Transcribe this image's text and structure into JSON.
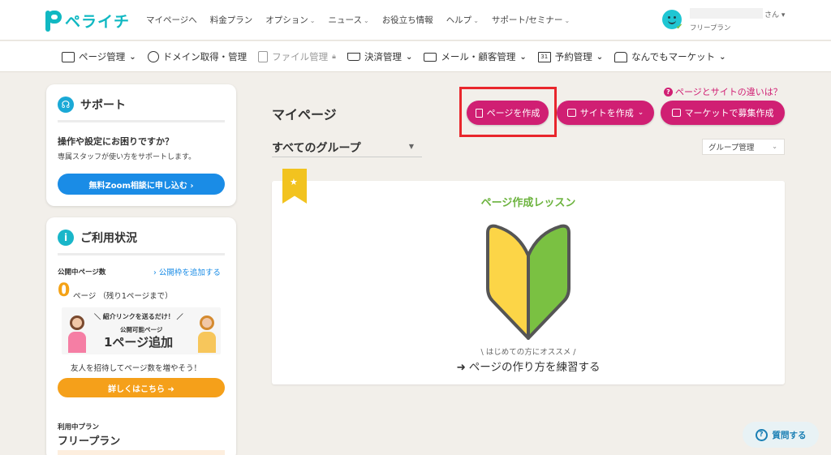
{
  "app": {
    "logo_text": "ペライチ"
  },
  "top_nav": {
    "items": [
      {
        "label": "マイページへ",
        "has_caret": false
      },
      {
        "label": "料金プラン",
        "has_caret": false
      },
      {
        "label": "オプション",
        "has_caret": true
      },
      {
        "label": "ニュース",
        "has_caret": true
      },
      {
        "label": "お役立ち情報",
        "has_caret": false
      },
      {
        "label": "ヘルプ",
        "has_caret": true
      },
      {
        "label": "サポート/セミナー",
        "has_caret": true
      }
    ]
  },
  "user": {
    "honorific": "さん",
    "plan": "フリープラン"
  },
  "sub_nav": {
    "items": [
      {
        "label": "ページ管理",
        "icon": "page-list-icon"
      },
      {
        "label": "ドメイン取得・管理",
        "icon": "globe-icon"
      },
      {
        "label": "ファイル管理",
        "icon": "file-icon",
        "locked": true
      },
      {
        "label": "決済管理",
        "icon": "cart-icon"
      },
      {
        "label": "メール・顧客管理",
        "icon": "mail-icon"
      },
      {
        "label": "予約管理",
        "icon": "calendar-icon",
        "icon_text": "31"
      },
      {
        "label": "なんでもマーケット",
        "icon": "shop-icon"
      }
    ]
  },
  "support": {
    "title": "サポート",
    "heading": "操作や設定にお困りですか？",
    "description": "専属スタッフが使い方をサポートします。",
    "button": "無料Zoom相談に申し込む"
  },
  "usage": {
    "title": "ご利用状況",
    "published_label": "公開中ページ数",
    "add_link": "公開枠を追加する",
    "count": "0",
    "count_text": "ページ （残り1ページまで）",
    "promo_top": "紹介リンクを送るだけ！",
    "promo_mid": "公開可能ページ",
    "promo_big": "1ページ追加",
    "invite_text": "友人を招待してページ数を増やそう！",
    "detail_button": "詳しくはこちら",
    "plan_label": "利用中プラン",
    "plan_value": "フリープラン"
  },
  "main": {
    "title": "マイページ",
    "diff_link": "ページとサイトの違いは？",
    "create_page": "ページを作成",
    "create_site": "サイトを作成",
    "market_recruit": "マーケットで募集作成",
    "group_select": "すべてのグループ",
    "group_manage": "グループ管理"
  },
  "lesson": {
    "title": "ページ作成レッスン",
    "note": "\\ はじめての方にオススメ /",
    "link": "ページの作り方を練習する"
  },
  "help": {
    "label": "質問する"
  },
  "colors": {
    "brand_teal": "#10b8c2",
    "primary_magenta": "#d01f73",
    "accent_orange": "#f4a216",
    "link_blue": "#1a8ce6",
    "highlight_red": "#e9262c",
    "lesson_green": "#6cb33e"
  }
}
